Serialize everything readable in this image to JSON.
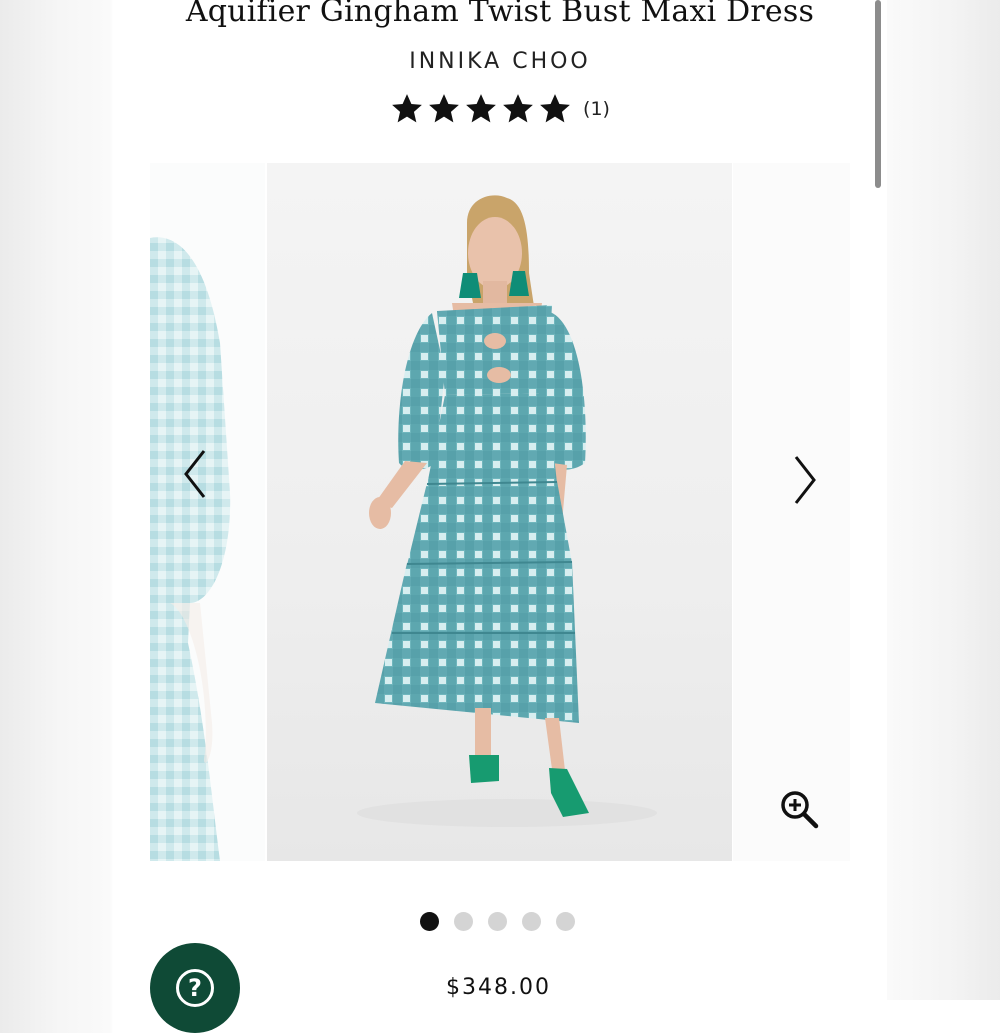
{
  "product": {
    "title": "Aquifier Gingham Twist Bust Maxi Dress",
    "brand": "INNIKA CHOO",
    "rating": 5,
    "review_count": "(1)",
    "price": "$348.00"
  },
  "carousel": {
    "slide_count": 5,
    "active_slide": 1,
    "icons": {
      "prev": "chevron-left-icon",
      "next": "chevron-right-icon",
      "zoom": "zoom-in-icon"
    }
  },
  "help": {
    "icon": "question-mark-icon",
    "glyph": "?"
  },
  "colors": {
    "dress_teal": "#5ba6ae",
    "help_button": "#0f4a36",
    "shoe_green": "#179b70"
  }
}
